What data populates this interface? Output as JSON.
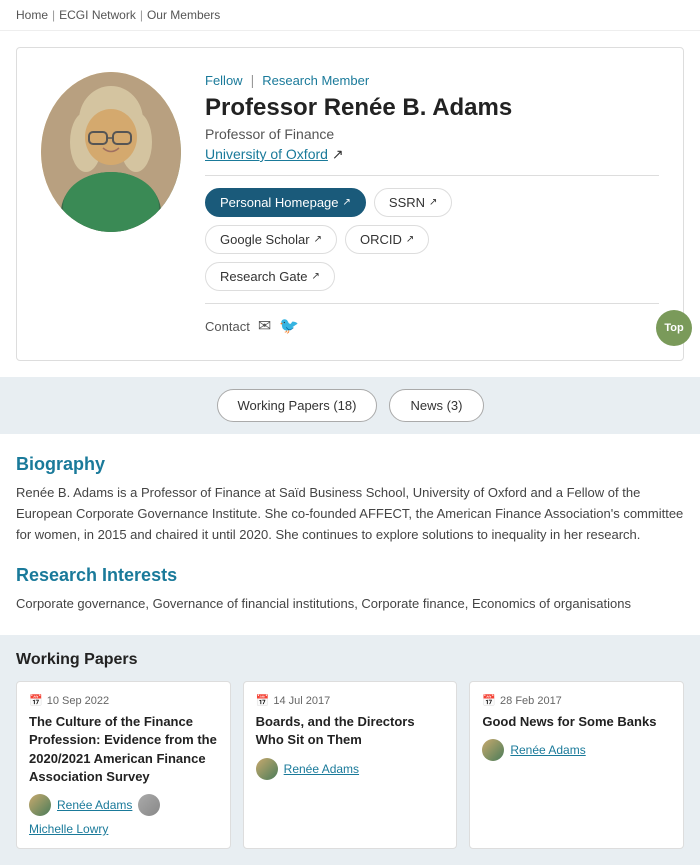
{
  "breadcrumb": {
    "items": [
      "Home",
      "ECGI Network",
      "Our Members"
    ]
  },
  "profile": {
    "badges": {
      "fellow": "Fellow",
      "separator": "|",
      "member": "Research Member"
    },
    "name": "Professor Renée B. Adams",
    "title": "Professor of Finance",
    "institution": "University of Oxford",
    "institution_url": "#",
    "links": [
      {
        "label": "Personal Homepage",
        "primary": true,
        "ext": true
      },
      {
        "label": "SSRN",
        "primary": false,
        "ext": true
      },
      {
        "label": "Google Scholar",
        "primary": false,
        "ext": true
      },
      {
        "label": "ORCID",
        "primary": false,
        "ext": true
      },
      {
        "label": "Research Gate",
        "primary": false,
        "ext": true
      }
    ],
    "contact_label": "Contact"
  },
  "top_button": "Top",
  "tabs": [
    {
      "label": "Working Papers (18)"
    },
    {
      "label": "News (3)"
    }
  ],
  "biography": {
    "title": "Biography",
    "text": "Renée B. Adams is a Professor of Finance at Saïd Business School, University of Oxford and a Fellow of the European Corporate Governance Institute. She co-founded AFFECT, the American Finance Association's committee for women, in 2015 and chaired it until 2020. She continues to explore solutions to inequality in her research."
  },
  "research_interests": {
    "title": "Research Interests",
    "text": "Corporate governance, Governance of financial institutions, Corporate finance, Economics of organisations"
  },
  "working_papers": {
    "title": "Working Papers",
    "papers": [
      {
        "date": "10 Sep 2022",
        "title": "The Culture of the Finance Profession: Evidence from the 2020/2021 American Finance Association Survey",
        "authors": [
          "Renée Adams",
          "Michelle Lowry"
        ]
      },
      {
        "date": "14 Jul 2017",
        "title": "Boards, and the Directors Who Sit on Them",
        "authors": [
          "Renée Adams"
        ]
      },
      {
        "date": "28 Feb 2017",
        "title": "Good News for Some Banks",
        "authors": [
          "Renée Adams"
        ]
      }
    ]
  }
}
